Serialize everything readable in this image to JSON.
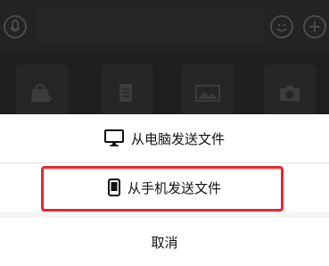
{
  "sheet": {
    "options": [
      {
        "label": "从电脑发送文件",
        "icon": "monitor-icon"
      },
      {
        "label": "从手机发送文件",
        "icon": "phone-icon"
      }
    ],
    "cancel_label": "取消"
  },
  "toolbar": {
    "icons": [
      "voice-icon",
      "emoji-icon",
      "plus-icon"
    ]
  },
  "tools": [
    {
      "icon": "bag-icon"
    },
    {
      "icon": "document-icon"
    },
    {
      "icon": "image-icon"
    },
    {
      "icon": "camera-icon"
    }
  ],
  "colors": {
    "highlight": "#e8262a",
    "overlay": "#1f1f1f",
    "sheet_bg": "#ffffff"
  }
}
